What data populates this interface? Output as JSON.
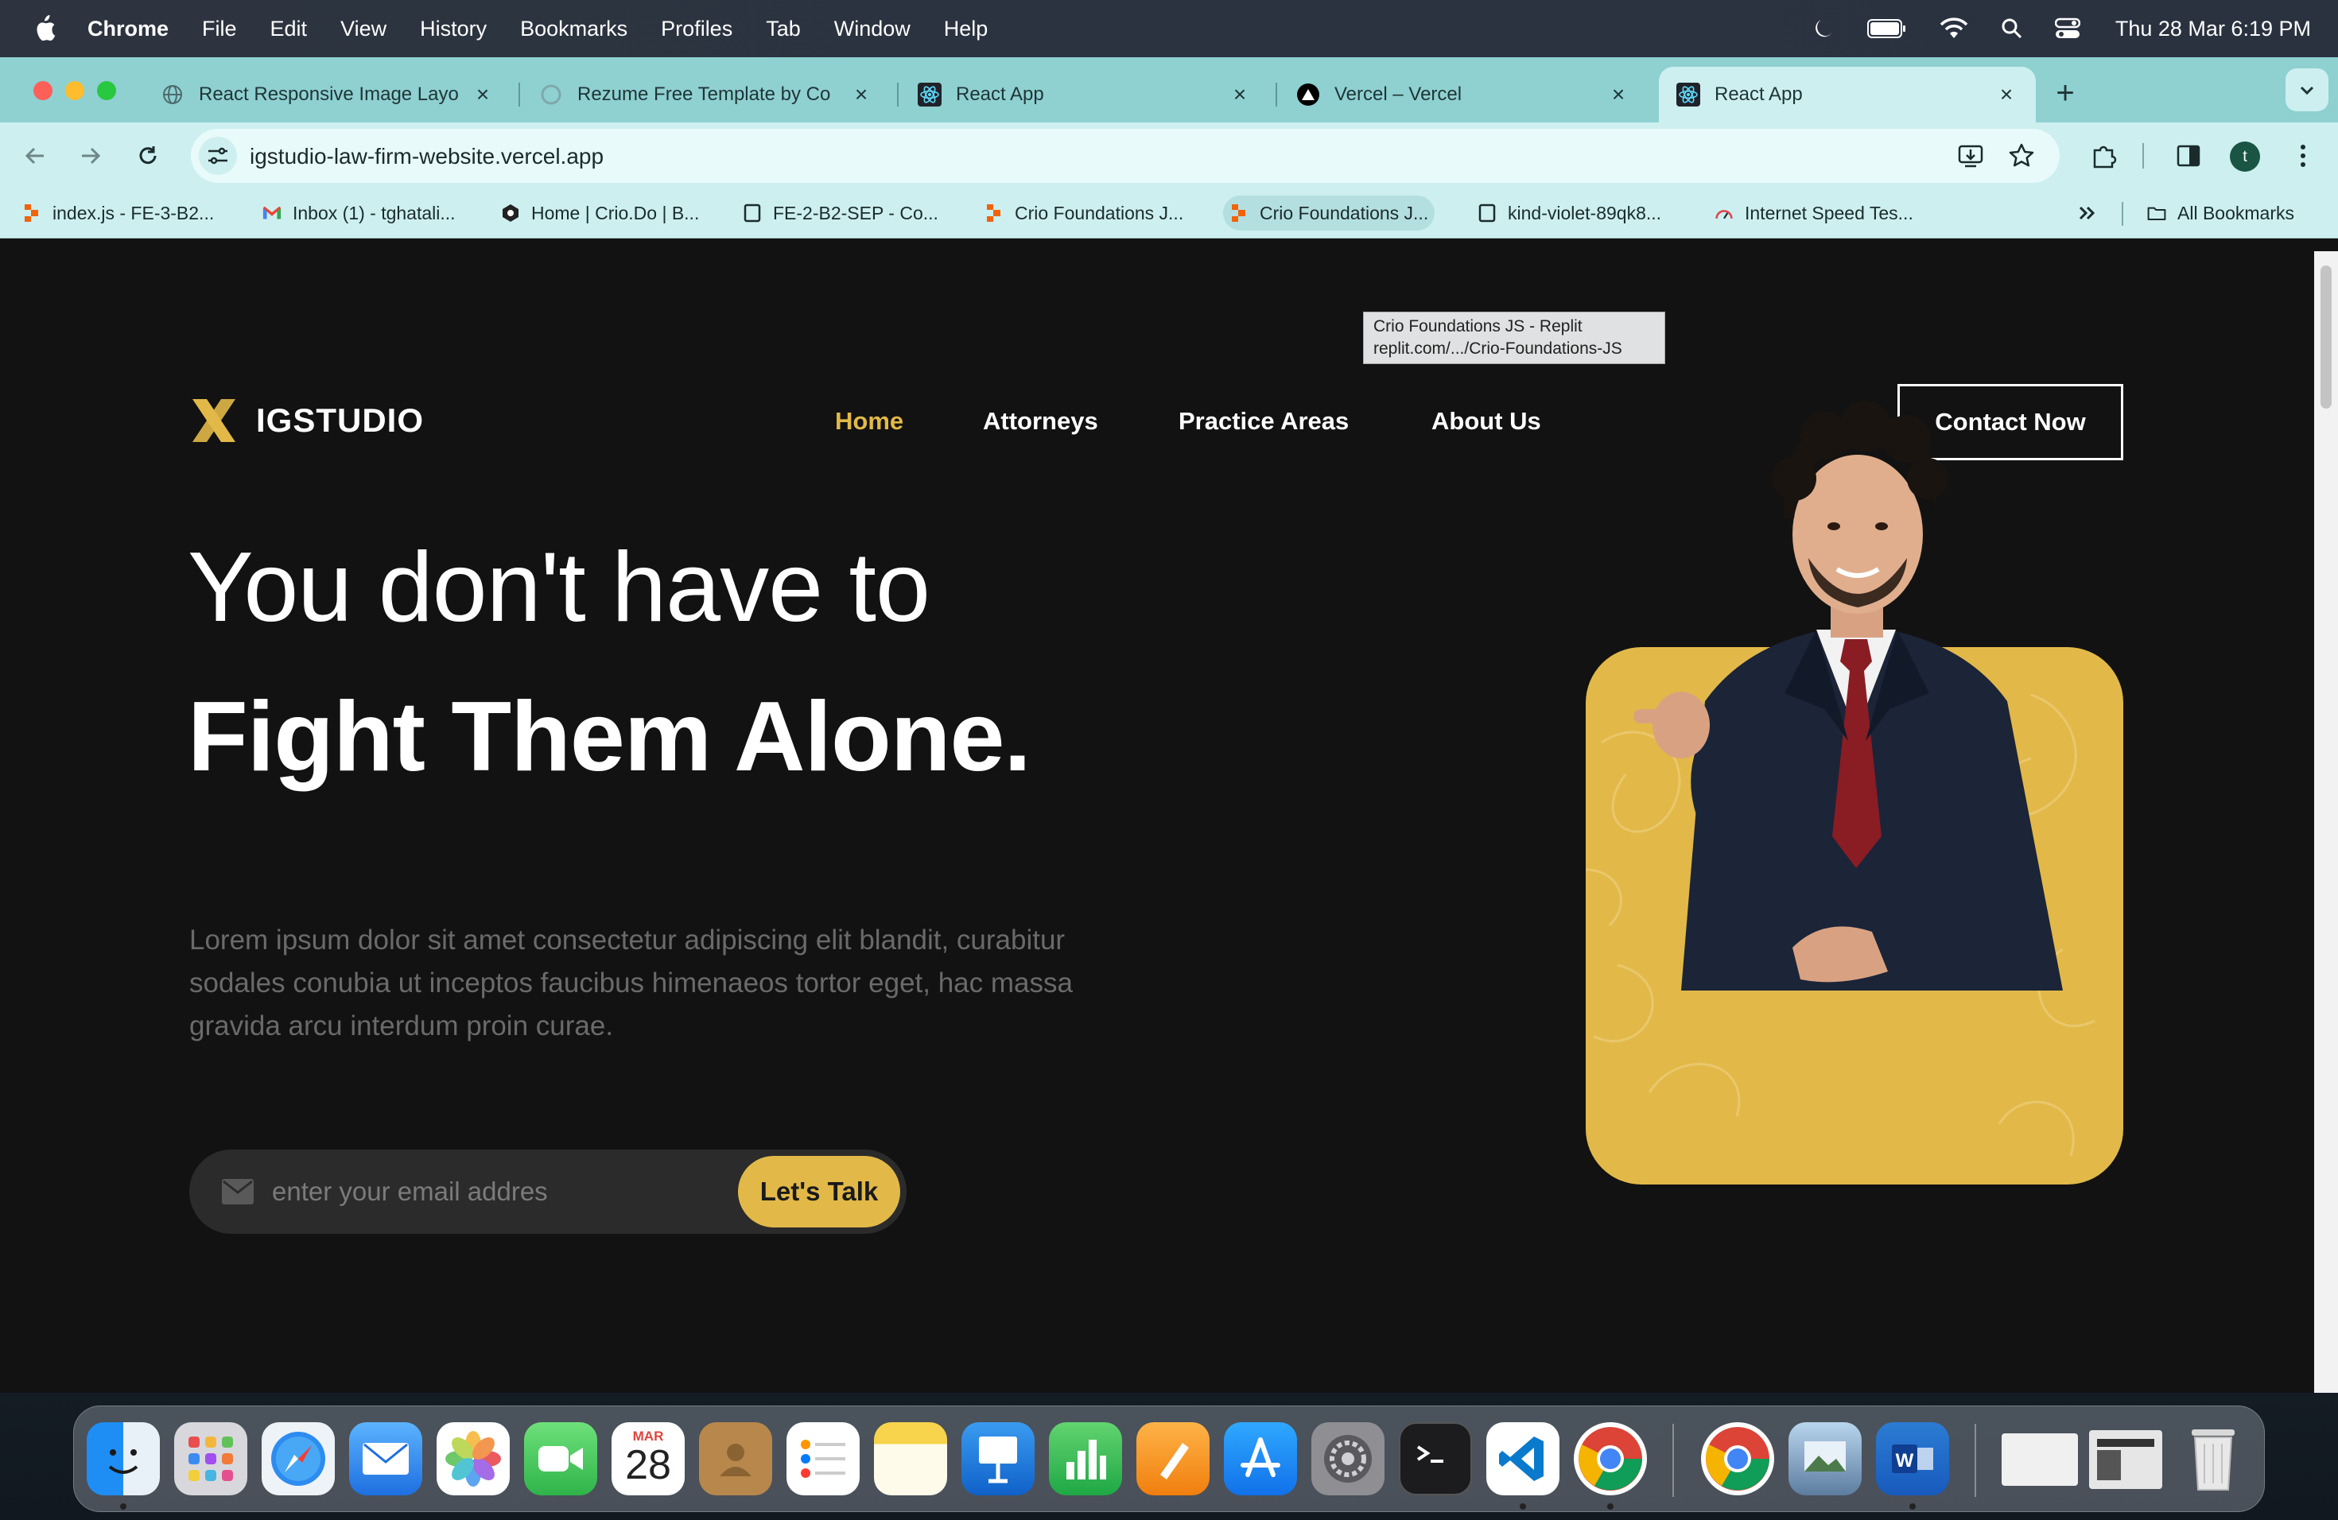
{
  "menubar": {
    "app_name": "Chrome",
    "items": [
      "File",
      "Edit",
      "View",
      "History",
      "Bookmarks",
      "Profiles",
      "Tab",
      "Window",
      "Help"
    ],
    "clock": "Thu 28 Mar  6:19 PM"
  },
  "tabs": [
    {
      "title": "React Responsive Image Layo",
      "icon": "generic-globe-icon",
      "active": false
    },
    {
      "title": "Rezume Free Template by Co",
      "icon": "loading-icon",
      "active": false
    },
    {
      "title": "React App",
      "icon": "react-icon",
      "active": false
    },
    {
      "title": "Vercel – Vercel",
      "icon": "vercel-icon",
      "active": false
    },
    {
      "title": "React App",
      "icon": "react-icon",
      "active": true
    }
  ],
  "toolbar": {
    "url": "igstudio-law-firm-website.vercel.app",
    "profile_initial": "t"
  },
  "bookmarks": [
    {
      "label": "index.js - FE-3-B2...",
      "icon": "replit-icon"
    },
    {
      "label": "Inbox (1) - tghatali...",
      "icon": "gmail-icon"
    },
    {
      "label": "Home | Crio.Do | B...",
      "icon": "crio-icon"
    },
    {
      "label": "FE-2-B2-SEP - Co...",
      "icon": "blank-page-icon"
    },
    {
      "label": "Crio Foundations J...",
      "icon": "replit-icon"
    },
    {
      "label": "Crio Foundations J...",
      "icon": "replit-icon"
    },
    {
      "label": "kind-violet-89qk8...",
      "icon": "blank-page-icon"
    },
    {
      "label": "Internet Speed Tes...",
      "icon": "speedtest-icon"
    }
  ],
  "bookmarks_folder": "All Bookmarks",
  "tooltip": {
    "line1": "Crio Foundations JS - Replit",
    "line2": "replit.com/.../Crio-Foundations-JS"
  },
  "site": {
    "brand": "IGSTUDIO",
    "nav": [
      "Home",
      "Attorneys",
      "Practice Areas",
      "About Us"
    ],
    "active_nav": "Home",
    "contact_label": "Contact Now",
    "hero_line1": "You don't have to",
    "hero_line2": "Fight Them Alone.",
    "description": "Lorem ipsum dolor sit amet consectetur adipiscing elit blandit, curabitur sodales conubia ut inceptos faucibus himenaeos tortor eget, hac massa gravida arcu interdum proin curae.",
    "email_placeholder": "enter your email addres",
    "cta_label": "Let's Talk",
    "accent_color": "#e2b948",
    "background_color": "#121212"
  },
  "dock": {
    "calendar_month": "MAR",
    "calendar_day": "28",
    "apps": [
      "finder-icon",
      "launchpad-icon",
      "safari-icon",
      "mail-icon",
      "photos-icon",
      "facetime-icon",
      "calendar-icon",
      "contacts-icon",
      "reminders-icon",
      "notes-icon",
      "keynote-icon",
      "numbers-icon",
      "pages-icon",
      "app-store-icon",
      "system-settings-icon",
      "terminal-icon",
      "vscode-icon",
      "chrome-icon",
      "chrome-icon",
      "preview-icon",
      "word-icon",
      "window-thumbnail-icon",
      "window-thumbnail-icon",
      "trash-icon"
    ]
  }
}
